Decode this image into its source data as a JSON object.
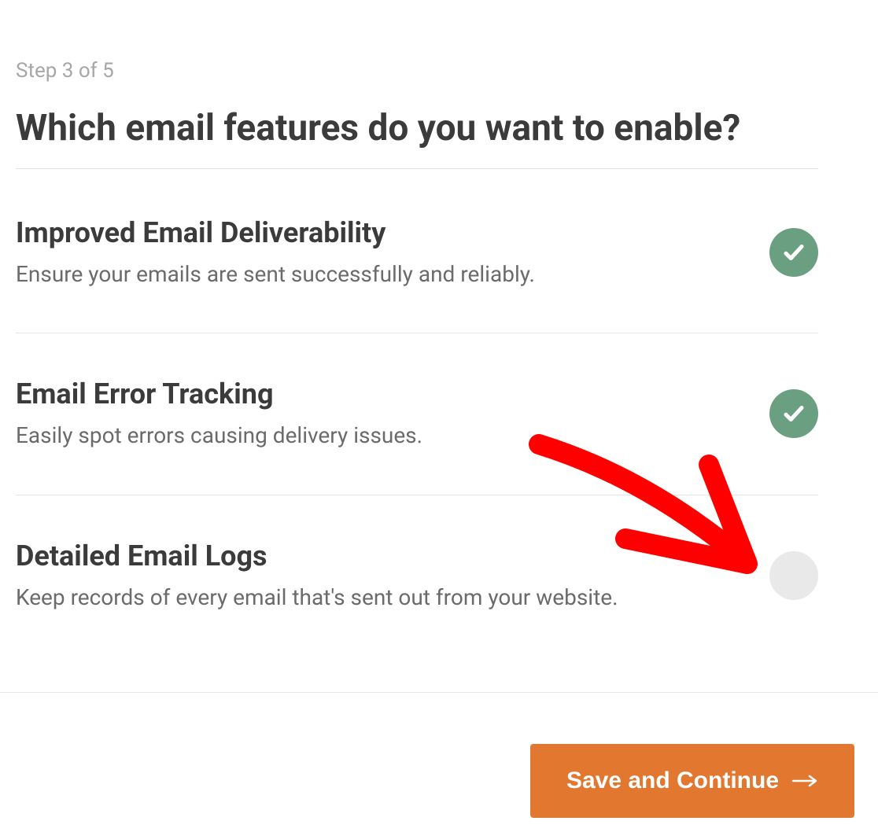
{
  "step_label": "Step 3 of 5",
  "page_title": "Which email features do you want to enable?",
  "features": [
    {
      "title": "Improved Email Deliverability",
      "desc": "Ensure your emails are sent successfully and reliably.",
      "enabled": true
    },
    {
      "title": "Email Error Tracking",
      "desc": "Easily spot errors causing delivery issues.",
      "enabled": true
    },
    {
      "title": "Detailed Email Logs",
      "desc": "Keep records of every email that's sent out from your website.",
      "enabled": false
    }
  ],
  "save_button_label": "Save and Continue",
  "colors": {
    "accent": "#e27730",
    "toggle_on": "#6aa081",
    "toggle_off": "#e9e9e9"
  }
}
